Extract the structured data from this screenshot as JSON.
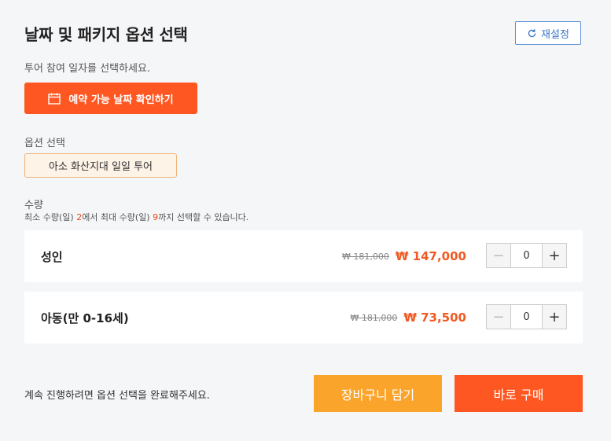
{
  "header": {
    "title": "날짜 및 패키지 옵션 선택",
    "reset_label": "재설정"
  },
  "date": {
    "prompt": "투어 참여 일자를 선택하세요.",
    "button_label": "예약 가능 날짜 확인하기"
  },
  "options": {
    "label": "옵션 선택",
    "selected": "아소 화산지대 일일 투어"
  },
  "quantity": {
    "label": "수량",
    "hint_prefix": "최소 수량(일) ",
    "min": "2",
    "hint_middle": "에서 최대 수량(일) ",
    "max": "9",
    "hint_suffix": "까지 선택할 수 있습니다."
  },
  "rows": [
    {
      "name": "성인",
      "original_price": "₩ 181,000",
      "sale_price": "₩ 147,000",
      "qty": "0"
    },
    {
      "name": "아동(만 0-16세)",
      "original_price": "₩ 181,000",
      "sale_price": "₩ 73,500",
      "qty": "0"
    }
  ],
  "stepper": {
    "minus": "−",
    "plus": "+"
  },
  "footer": {
    "note": "계속 진행하려면 옵션 선택을 완료해주세요.",
    "cart_label": "장바구니 담기",
    "buy_label": "바로 구매"
  },
  "colors": {
    "accent": "#ff5722",
    "cart": "#fba42c",
    "price": "#f05a23",
    "link": "#3a74c7"
  }
}
